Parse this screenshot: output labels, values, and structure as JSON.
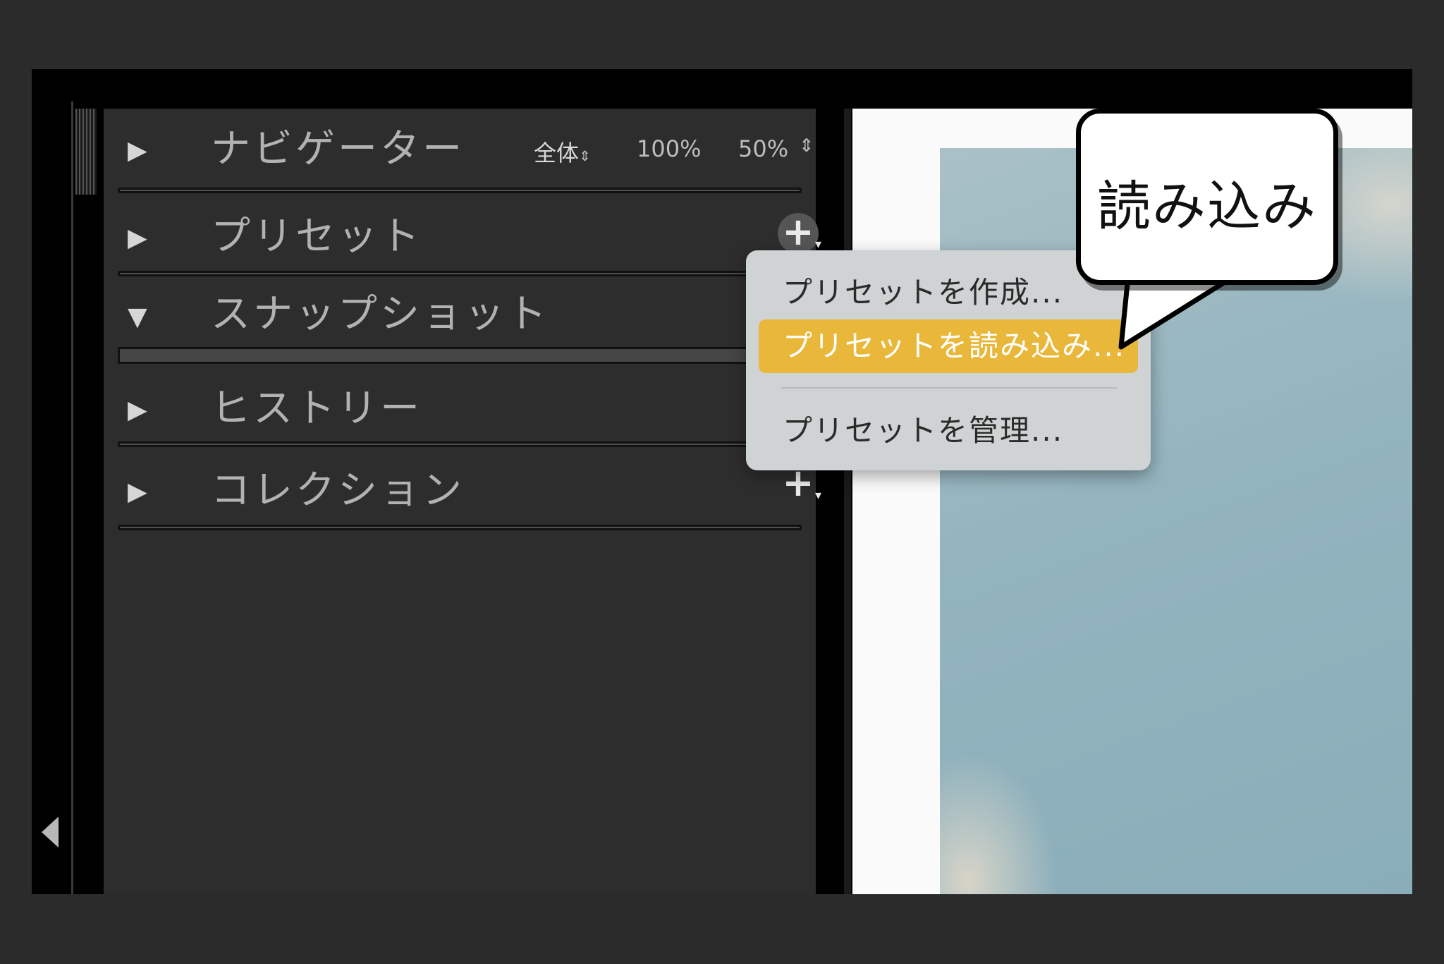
{
  "panel": {
    "sections": [
      {
        "arrow": "▶",
        "title": "ナビゲーター"
      },
      {
        "arrow": "▶",
        "title": "プリセット"
      },
      {
        "arrow": "▼",
        "title": "スナップショット"
      },
      {
        "arrow": "▶",
        "title": "ヒストリー"
      },
      {
        "arrow": "▶",
        "title": "コレクション"
      }
    ],
    "navigator": {
      "fit": "全体",
      "zoom_a": "100%",
      "zoom_b": "50%"
    }
  },
  "menu": {
    "items": [
      {
        "label": "プリセットを作成..."
      },
      {
        "label": "プリセットを読み込み..."
      },
      {
        "label": "プリセットを管理..."
      }
    ],
    "selected_index": 1,
    "highlight_color": "#e9b73a"
  },
  "callout": {
    "text": "読み込み"
  },
  "icons": {
    "plus": "add-icon",
    "stepper": "stepper-arrows-icon",
    "collapse": "collapse-left-icon"
  }
}
